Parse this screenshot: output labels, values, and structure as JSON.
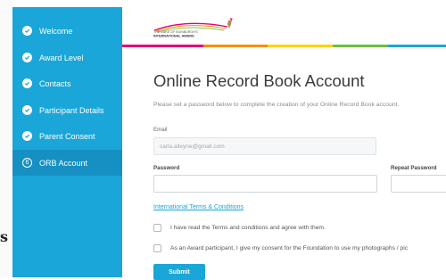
{
  "sidebar": {
    "items": [
      {
        "label": "Welcome",
        "status": "done",
        "icon": "check-circle-icon"
      },
      {
        "label": "Award Level",
        "status": "done",
        "icon": "check-circle-icon"
      },
      {
        "label": "Contacts",
        "status": "done",
        "icon": "check-circle-icon"
      },
      {
        "label": "Participant Details",
        "status": "done",
        "icon": "check-circle-icon"
      },
      {
        "label": "Parent Consent",
        "status": "done",
        "icon": "check-circle-icon"
      },
      {
        "label": "ORB Account",
        "status": "active",
        "icon": "step-number-icon",
        "number": "6"
      }
    ]
  },
  "header": {
    "logo_line1": "THE DUKE OF EDINBURGH'S",
    "logo_line2": "INTERNATIONAL AWARD",
    "rainbow_colors": [
      "#e2007a",
      "#f29200",
      "#ffd200",
      "#6fbf3f",
      "#1aa6d8"
    ]
  },
  "form": {
    "title": "Online Record Book Account",
    "subtitle": "Please set a password below to complete the creation of your Online Record Book account.",
    "email_label": "Email",
    "email_value": "carla.alleyne@gmail.com",
    "password_label": "Password",
    "repeat_password_label": "Repeat Password",
    "terms_link": "International Terms & Conditions",
    "checkbox_terms": "I have read the Terms and conditions and agree with them.",
    "checkbox_consent": "As an Award participant, I give my consent for the Foundation to use my photographs / pic",
    "submit_label": "Submit"
  },
  "edge_glyph": "s",
  "colors": {
    "sidebar": "#1aa6d8",
    "sidebar_active": "#1690c3",
    "accent": "#1aa6d8",
    "title_text": "#3b3b3b"
  }
}
